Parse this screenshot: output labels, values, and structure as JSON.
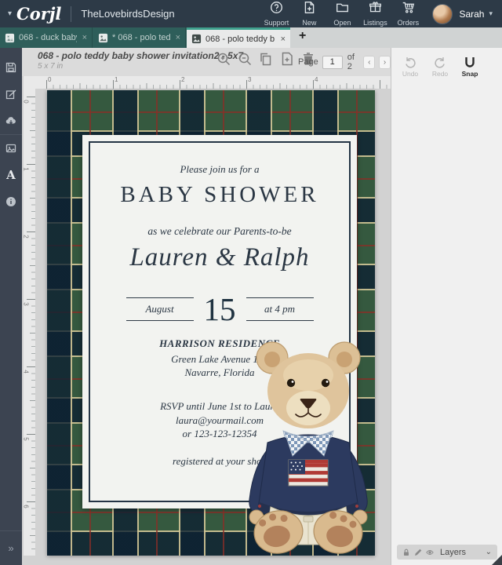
{
  "header": {
    "logo": "Corjl",
    "workspace": "TheLovebirdsDesign",
    "nav": [
      {
        "label": "Support"
      },
      {
        "label": "New"
      },
      {
        "label": "Open"
      },
      {
        "label": "Listings"
      },
      {
        "label": "Orders"
      }
    ],
    "user_name": "Sarah"
  },
  "tabs": {
    "items": [
      {
        "label": "068 - duck baby s..."
      },
      {
        "label": "* 068 - polo tedd..."
      },
      {
        "label": "068 - polo teddy b..."
      }
    ],
    "new_tab_label": "+",
    "close_glyph": "×"
  },
  "toolbar": {
    "doc_title": "068 - polo teddy baby shower invitation2 - 5x7",
    "doc_size": "5 x 7 in",
    "page_label": "Page",
    "page_value": "1",
    "page_total_label": "of 2",
    "prev_glyph": "‹",
    "next_glyph": "›"
  },
  "history": {
    "undo_label": "Undo",
    "redo_label": "Redo",
    "snap_label": "Snap"
  },
  "rulers": {
    "horizontal": [
      "0",
      "1",
      "2",
      "3",
      "4"
    ],
    "vertical": [
      "0",
      "1",
      "2",
      "3",
      "4",
      "5",
      "6"
    ]
  },
  "invitation": {
    "intro": "Please join us for a",
    "title": "BABY SHOWER",
    "subtitle": "as we celebrate our Parents-to-be",
    "couple_names": "Lauren & Ralph",
    "date_month": "August",
    "date_day": "15",
    "date_time": "at 4 pm",
    "venue": "HARRISON RESIDENCE",
    "address_line1": "Green Lake Avenue 123",
    "address_line2": "Navarre, Florida",
    "rsvp_line1": "RSVP until June 1st to Laura",
    "rsvp_line2": "laura@yourmail.com",
    "rsvp_line3": "or 123-123-12354",
    "registry": "registered at your shop"
  },
  "layers_panel": {
    "label": "Layers"
  },
  "misc": {
    "sidebar_expand_glyph": "»",
    "caret_down": "▾"
  },
  "colors": {
    "header_bg": "#2d3a47",
    "tab_teal": "#2e5e5a",
    "active_tab_accent": "#3fa08d",
    "sidebar_bg": "#3c4451",
    "card_bg": "#f2f3f0",
    "card_navy": "#243445",
    "plaid_green": "#35593f",
    "plaid_navy": "#16293a",
    "plaid_cream": "#d2c696",
    "plaid_red": "#8c372d",
    "sweater_navy": "#2c3a5f"
  }
}
